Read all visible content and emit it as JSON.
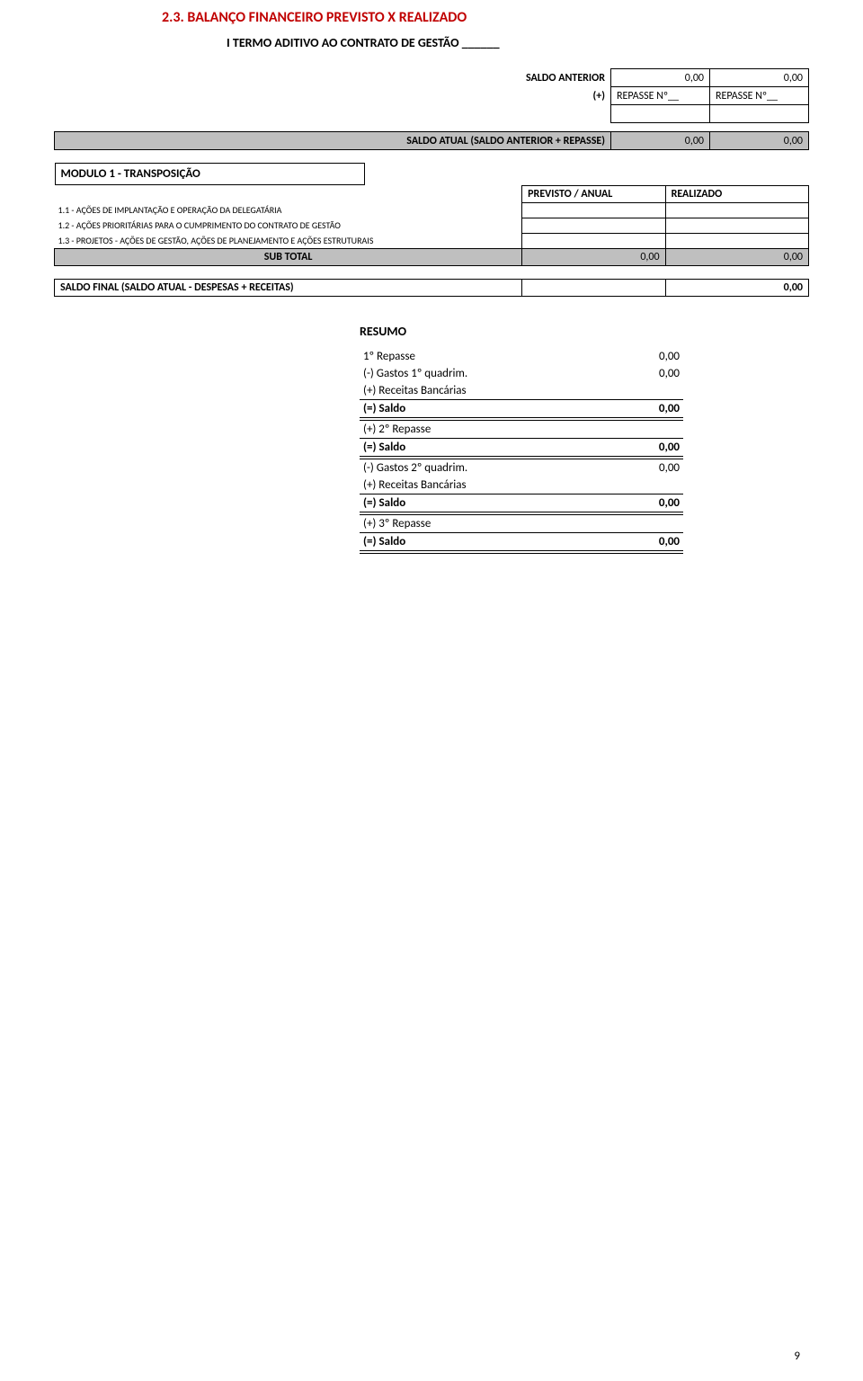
{
  "section_title": "2.3. BALANÇO FINANCEIRO PREVISTO X REALIZADO",
  "subtitle": "I TERMO ADITIVO AO CONTRATO DE GESTÃO ______",
  "header_block": {
    "saldo_anterior_label": "SALDO ANTERIOR",
    "saldo_anterior_v1": "0,00",
    "saldo_anterior_v2": "0,00",
    "plus_label": "(+)",
    "repasse1": "REPASSE Nº__",
    "repasse2": "REPASSE Nº__",
    "saldo_atual_label": "SALDO ATUAL (SALDO ANTERIOR + REPASSE)",
    "saldo_atual_v1": "0,00",
    "saldo_atual_v2": "0,00"
  },
  "modulo_title": "MODULO 1  -   TRANSPOSIÇÃO",
  "col_headers": {
    "previsto": "PREVISTO / ANUAL",
    "realizado": "REALIZADO"
  },
  "rows": [
    "1.1 - AÇÕES DE IMPLANTAÇÃO E OPERAÇÃO DA DELEGATÁRIA",
    "1.2 - AÇÕES PRIORITÁRIAS PARA O CUMPRIMENTO DO CONTRATO DE GESTÃO",
    "1.3 - PROJETOS - AÇÕES DE GESTÃO, AÇÕES DE PLANEJAMENTO E AÇÕES ESTRUTURAIS"
  ],
  "subtotal": {
    "label": "SUB TOTAL",
    "v1": "0,00",
    "v2": "0,00"
  },
  "saldo_final": {
    "label": "SALDO FINAL (SALDO ATUAL - DESPESAS + RECEITAS)",
    "value": "0,00"
  },
  "resumo": {
    "title": "RESUMO",
    "lines": [
      {
        "label": "1º Repasse",
        "value": "0,00",
        "bold": false
      },
      {
        "label": "(-) Gastos 1º quadrim.",
        "value": "0,00",
        "bold": false
      },
      {
        "label": "(+) Receitas Bancárias",
        "value": "",
        "bold": false
      },
      {
        "label": "(=) Saldo",
        "value": "0,00",
        "bold": true,
        "dbl": true
      },
      {
        "label": "(+) 2º Repasse",
        "value": "",
        "bold": false
      },
      {
        "label": "(=) Saldo",
        "value": "0,00",
        "bold": true,
        "dbl": true
      },
      {
        "label": "(-) Gastos 2º quadrim.",
        "value": "0,00",
        "bold": false
      },
      {
        "label": "(+) Receitas Bancárias",
        "value": "",
        "bold": false
      },
      {
        "label": "(=) Saldo",
        "value": "0,00",
        "bold": true,
        "dbl": true
      },
      {
        "label": "(+) 3º Repasse",
        "value": "",
        "bold": false
      },
      {
        "label": "(=) Saldo",
        "value": "0,00",
        "bold": true,
        "dbl": true
      }
    ]
  },
  "page_number": "9"
}
